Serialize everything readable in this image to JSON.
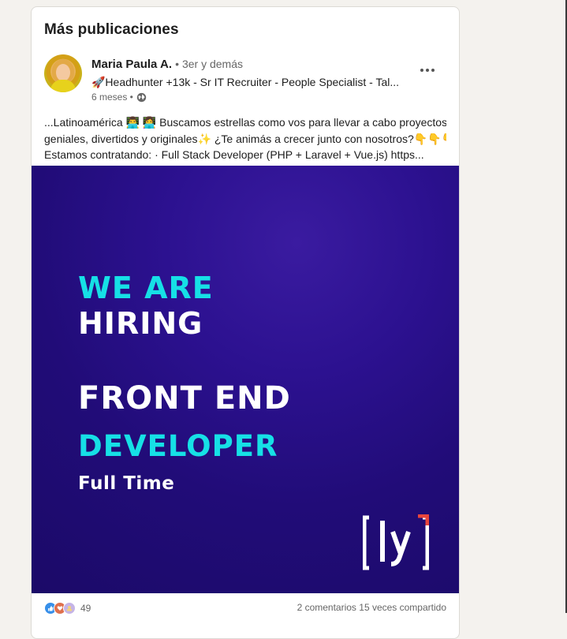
{
  "section": {
    "title": "Más publicaciones"
  },
  "post": {
    "author": {
      "name": "Maria Paula A.",
      "degree": "• 3er y demás",
      "headline": "🚀Headhunter +13k - Sr IT Recruiter - People Specialist - Tal...",
      "time": "6 meses •",
      "visibility_icon": "globe-icon"
    },
    "more_icon": "ellipsis-icon",
    "text_lines": [
      "...Latinoamérica 👨‍💻 👩‍💻 Buscamos estrellas como vos para llevar a cabo proyectos",
      "geniales, divertidos y originales✨ ¿Te animás a crecer junto con nosotros?👇👇👇",
      "Estamos contratando: ·  Full Stack Developer (PHP + Laravel + Vue.js) https..."
    ],
    "image": {
      "line1": "WE ARE",
      "line2": "HIRING",
      "line3": "FRONT END",
      "line4": "DEVELOPER",
      "line5": "Full Time",
      "logo_text": "[ly]",
      "colors": {
        "accent": "#16e0e6",
        "background": "#210c78",
        "logo_accent": "#e8453c"
      }
    },
    "social": {
      "reaction_icons": [
        "like-icon",
        "love-icon",
        "support-icon"
      ],
      "reactions_count": "49",
      "comments_shares": "2 comentarios 15 veces compartido"
    }
  }
}
